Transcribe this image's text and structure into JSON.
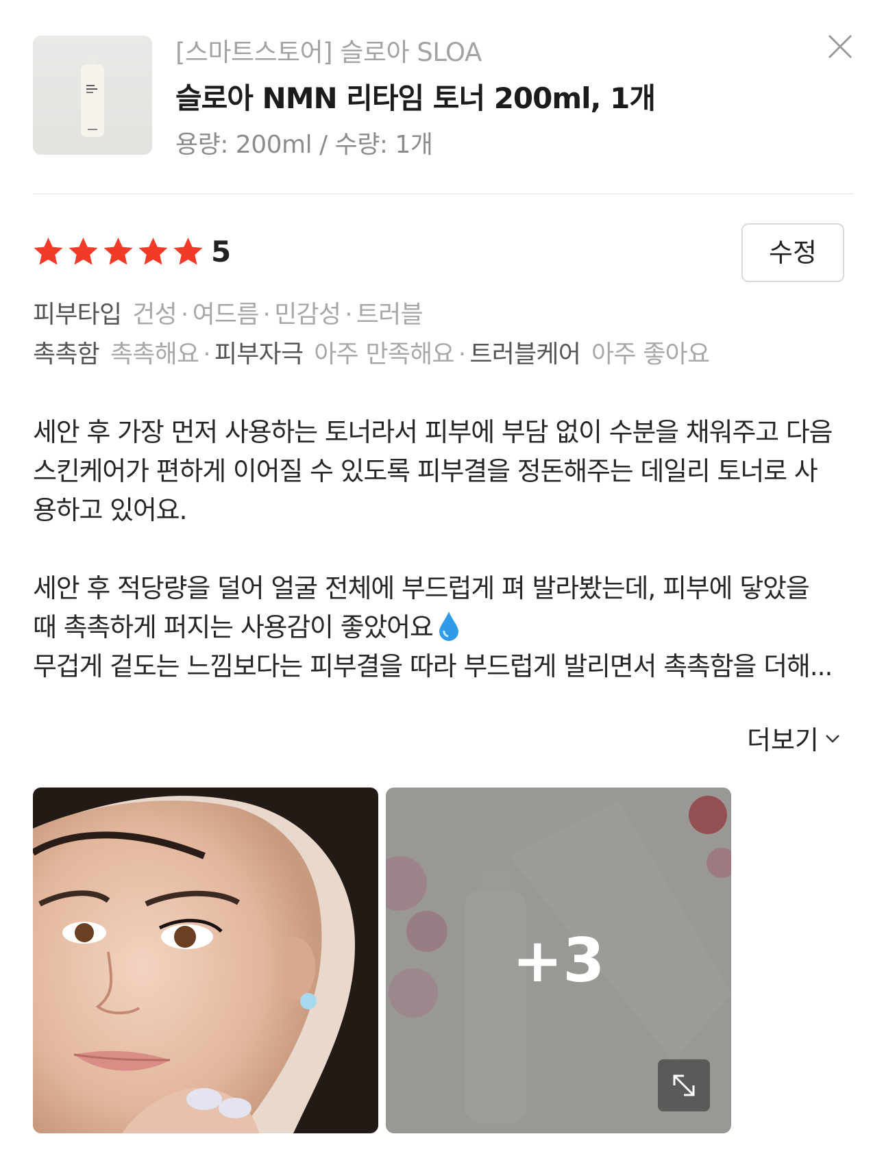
{
  "product": {
    "store_line": "[스마트스토어] 슬로아 SLOA",
    "title": "슬로아 NMN 리타임 토너 200ml, 1개",
    "option_line": "용량: 200ml / 수량: 1개",
    "thumb_alt": "product-thumbnail"
  },
  "rating": {
    "score": "5",
    "stars": 5,
    "star_color": "#f23b26",
    "edit_label": "수정"
  },
  "attributes": {
    "skin_type": {
      "label": "피부타입",
      "values": [
        "건성",
        "여드름",
        "민감성",
        "트러블"
      ]
    },
    "evaluations": [
      {
        "label": "촉촉함",
        "value": "촉촉해요"
      },
      {
        "label": "피부자극",
        "value": "아주 만족해요"
      },
      {
        "label": "트러블케어",
        "value": "아주 좋아요"
      }
    ]
  },
  "review": {
    "paragraph1": "세안 후 가장 먼저 사용하는 토너라서 피부에 부담 없이 수분을 채워주고 다음\n스킨케어가 편하게 이어질 수 있도록 피부결을 정돈해주는 데일리 토너로 사\n용하고 있어요.",
    "paragraph2a": "세안 후 적당량을 덜어 얼굴 전체에 부드럽게 펴 발라봤는데, 피부에 닿았을\n때 촉촉하게 퍼지는 사용감이 좋았어요",
    "paragraph2b": "무겁게 겉도는 느낌보다는 피부결을 따라 부드럽게 발리면서 촉촉함을 더해...",
    "more_label": "더보기"
  },
  "photos": {
    "extra_count": "+3",
    "icons": [
      "expand-icon",
      "chevron-down-icon",
      "close-icon",
      "water-drop-icon"
    ]
  }
}
